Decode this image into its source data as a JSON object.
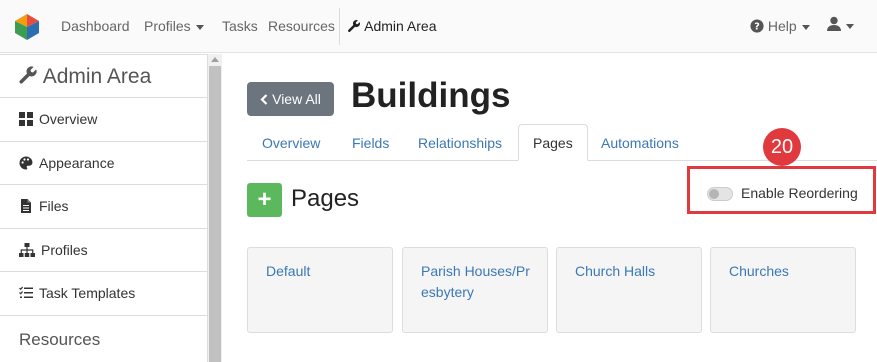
{
  "topbar": {
    "nav": {
      "dashboard": "Dashboard",
      "profiles": "Profiles",
      "tasks": "Tasks",
      "resources": "Resources",
      "admin_area": "Admin Area"
    },
    "help": "Help",
    "icons": [
      "app-logo-icon",
      "wrench-icon",
      "question-circle-icon",
      "user-icon",
      "chevron-down-icon"
    ]
  },
  "sidebar": {
    "title": "Admin Area",
    "items": [
      {
        "label": "Overview",
        "icon": "th-large-icon"
      },
      {
        "label": "Appearance",
        "icon": "palette-icon"
      },
      {
        "label": "Files",
        "icon": "file-icon"
      },
      {
        "label": "Profiles",
        "icon": "sitemap-icon"
      },
      {
        "label": "Task Templates",
        "icon": "tasks-icon"
      }
    ],
    "section": "Resources"
  },
  "main": {
    "view_all": "View All",
    "title": "Buildings",
    "tabs": [
      {
        "label": "Overview"
      },
      {
        "label": "Fields"
      },
      {
        "label": "Relationships"
      },
      {
        "label": "Pages",
        "active": true
      },
      {
        "label": "Automations"
      }
    ],
    "section_title": "Pages",
    "add_label": "+",
    "reorder_label": "Enable Reordering",
    "reorder_enabled": false,
    "annotation_number": "20",
    "pages": [
      "Default",
      "Parish Houses/Presbytery",
      "Church Halls",
      "Churches"
    ]
  },
  "colors": {
    "link": "#3b78b6",
    "add_button": "#5cb85c",
    "view_all_button": "#6c757d",
    "highlight": "#e0393e"
  }
}
